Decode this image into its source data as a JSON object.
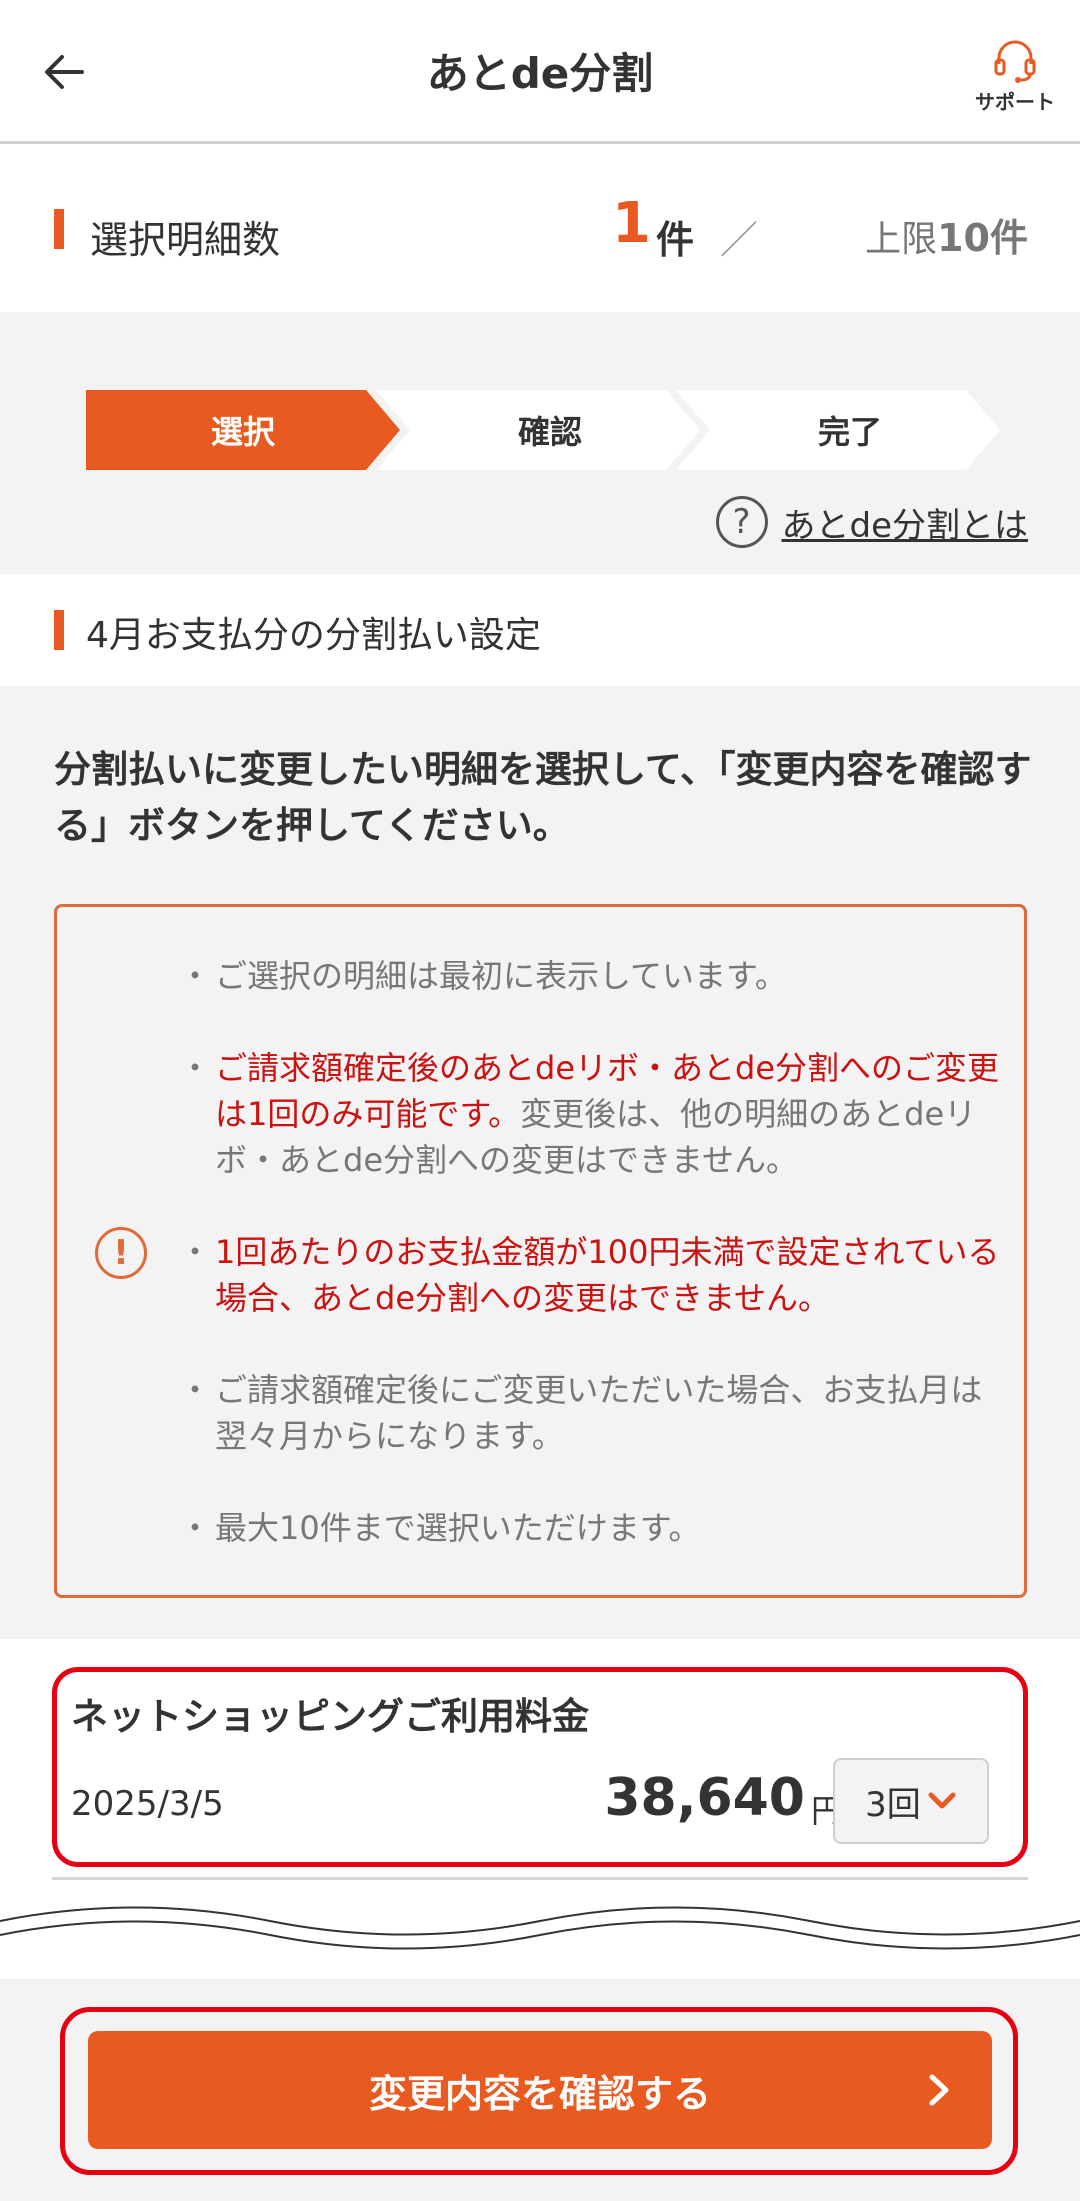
{
  "header": {
    "title": "あとde分割",
    "support_label": "サポート"
  },
  "selection": {
    "label": "選択明細数",
    "count": "1",
    "unit": "件",
    "slash": "／",
    "limit_prefix": "上限",
    "limit_value": "10件"
  },
  "steps": [
    {
      "label": "選択",
      "active": true
    },
    {
      "label": "確認",
      "active": false
    },
    {
      "label": "完了",
      "active": false
    }
  ],
  "about_link": "あとde分割とは",
  "section_title": "4月お支払分の分割払い設定",
  "instruction": "分割払いに変更したい明細を選択して、「変更内容を確認する」ボタンを押してください。",
  "notices": {
    "n1": "ご選択の明細は最初に表示しています。",
    "n2_red": "ご請求額確定後のあとdeリボ・あとde分割へのご変更は1回のみ可能です。",
    "n2_rest": "変更後は、他の明細のあとdeリボ・あとde分割への変更はできません。",
    "n3_red": "1回あたりのお支払金額が100円未満で設定されている場合、あとde分割への変更はできません。",
    "n4": "ご請求額確定後にご変更いただいた場合、お支払月は翌々月からになります。",
    "n5": "最大10件まで選択いただけます。"
  },
  "card": {
    "name": "ネットショッピングご利用料金",
    "date": "2025/3/5",
    "amount": "38,640",
    "currency": "円",
    "installments": "3回"
  },
  "confirm_button": "変更内容を確認する",
  "colors": {
    "accent": "#e85a1f",
    "highlight_outline": "#e60012",
    "warning_text": "#cc1111"
  },
  "icons": [
    "back-arrow-icon",
    "headset-icon",
    "question-icon",
    "exclamation-icon",
    "chevron-down-icon",
    "chevron-right-icon"
  ]
}
